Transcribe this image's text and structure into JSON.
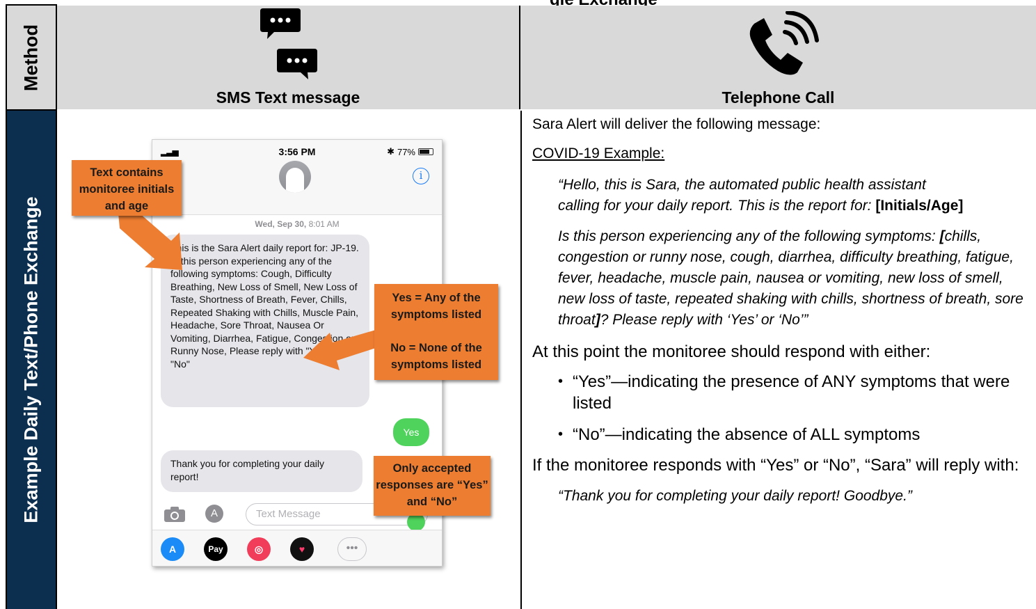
{
  "top_title_fragment": "gle Exchange",
  "side": {
    "method_label": "Method",
    "example_label": "Example Daily Text/Phone Exchange"
  },
  "methods": {
    "sms_caption": "SMS Text message",
    "tel_caption": "Telephone Call"
  },
  "phone": {
    "status_time": "3:56 PM",
    "battery_pct": "77%",
    "date_day": "Wed, Sep 30,",
    "date_time": "8:01 AM",
    "message_in_1": "This is the Sara Alert daily report for: JP-19. Is this person experiencing any of the following symptoms: Cough, Difficulty Breathing, New Loss of Smell, New Loss of Taste, Shortness of Breath, Fever, Chills, Repeated Shaking with Chills, Muscle Pain, Headache, Sore Throat, Nausea Or Vomiting, Diarrhea, Fatigue, Congestion or Runny Nose, Please reply with \"Yes\" or \"No\"",
    "message_out": "Yes",
    "message_in_2": "Thank you for completing your daily report!",
    "input_placeholder": "Text Message",
    "tray_apps": [
      "app-store",
      "apple-pay",
      "search-images",
      "digital-touch",
      "more"
    ],
    "tray_pay_label": "\u0000Pay"
  },
  "callouts": {
    "initials": "Text contains monitoree initials and age",
    "yes_line": "Yes = Any of the symptoms listed",
    "no_line": "No = None of the symptoms listed",
    "only": "Only accepted responses are “Yes” and “No”"
  },
  "telephone": {
    "intro": "Sara Alert will deliver the following message:",
    "example_heading": "COVID-19 Example:",
    "quote1_text": "“Hello, this is Sara, the automated public health assistant calling for your daily report. This is the report for: ",
    "quote1_bold": "[Initials/Age]",
    "quote2_prefix": "Is this person experiencing any of the following symptoms: ",
    "quote2_open": "[",
    "quote2_symptoms": "chills, congestion or runny nose, cough, diarrhea, difficulty breathing, fatigue, fever, headache, muscle pain, nausea or vomiting, new loss of smell, new loss of taste, repeated shaking with chills, shortness of breath, sore throat",
    "quote2_close": "]",
    "quote2_suffix": "? Please reply with ‘Yes’ or ‘No’”",
    "respond_intro": "At this point the monitoree should respond with either:",
    "bullet_yes": "“Yes”—indicating the presence of ANY symptoms that were listed",
    "bullet_no": "“No”—indicating the absence of ALL symptoms",
    "if_text": "If the monitoree responds with “Yes” or “No”, “Sara” will reply with:",
    "goodbye": "“Thank you for completing your daily report! Goodbye.”"
  },
  "colors": {
    "navy": "#0d2f4f",
    "gray_header": "#d9d9d9",
    "orange_callout": "#ed7d31",
    "imessage_green": "#4fd35c",
    "ios_blue": "#1a7cf5"
  }
}
